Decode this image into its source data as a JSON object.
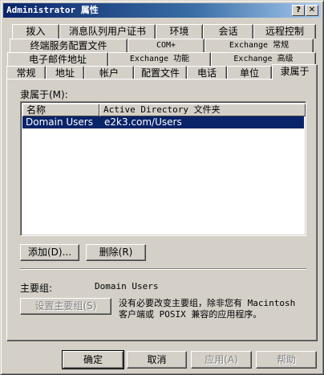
{
  "window": {
    "title": "Administrator 属性",
    "help_glyph": "?",
    "close_glyph": "✕"
  },
  "tabs": {
    "row1": [
      "拨入",
      "消息队列用户证书",
      "环境",
      "会话",
      "远程控制"
    ],
    "row2": [
      "终端服务配置文件",
      "COM+",
      "Exchange 常规"
    ],
    "row3": [
      "电子邮件地址",
      "Exchange 功能",
      "Exchange 高级"
    ],
    "row4": [
      "常规",
      "地址",
      "帐户",
      "配置文件",
      "电话",
      "单位",
      "隶属于"
    ]
  },
  "member_of": {
    "label": "隶属于(M):",
    "columns": [
      "名称",
      "Active Directory 文件夹"
    ],
    "rows": [
      {
        "name": "Domain Users",
        "folder": "e2k3.com/Users"
      }
    ],
    "add_button": "添加(D)...",
    "remove_button": "删除(R)"
  },
  "primary_group": {
    "label": "主要组:",
    "value": "Domain Users",
    "set_button": "设置主要组(S)",
    "note_line1": "没有必要改变主要组，除非您有 Macintosh",
    "note_line2": "客户端或 POSIX 兼容的应用程序。"
  },
  "footer": {
    "ok": "确定",
    "cancel": "取消",
    "apply": "应用(A)",
    "help": "帮助"
  }
}
